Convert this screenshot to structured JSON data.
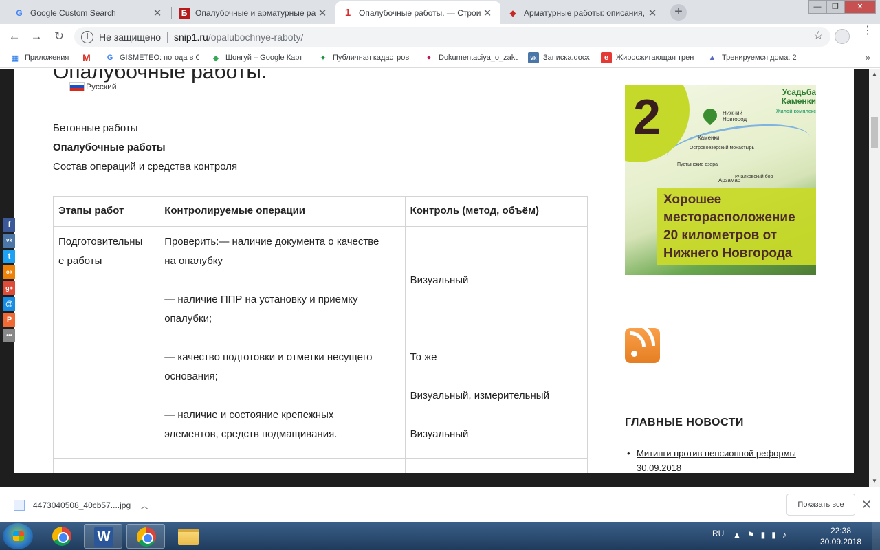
{
  "browser": {
    "tabs": [
      {
        "title": "Google Custom Search",
        "icon": "G",
        "icon_color": "#4285f4",
        "active": false
      },
      {
        "title": "Опалубочные и арматурные работ",
        "icon": "Б",
        "icon_color": "#b71c1c",
        "active": false
      },
      {
        "title": "Опалубочные работы. — Строител",
        "icon": "1",
        "icon_color": "#d32f2f",
        "active": true
      },
      {
        "title": "Арматурные работы: описания, эта",
        "icon": "◆",
        "icon_color": "#c62828",
        "active": false
      }
    ],
    "new_tab_glyph": "+",
    "window_controls": {
      "minimize": "—",
      "maximize": "❐",
      "close": "✕"
    },
    "nav": {
      "back": "←",
      "forward": "→",
      "reload": "↻"
    },
    "security_label": "Не защищено",
    "url_host": "snip1.ru",
    "url_path": "/opalubochnye-raboty/",
    "star": "☆",
    "menu": "⋮",
    "bookmarks": [
      {
        "label": "Приложения",
        "icon": "▦",
        "color": "#1a73e8"
      },
      {
        "label": "",
        "icon": "M",
        "color": "#d93025"
      },
      {
        "label": "GISMETEO: погода в С",
        "icon": "G",
        "color": "#4285f4"
      },
      {
        "label": "Шонгуй – Google Карт",
        "icon": "◆",
        "color": "#34a853"
      },
      {
        "label": "Публичная кадастров",
        "icon": "✦",
        "color": "#1e8e3e"
      },
      {
        "label": "Dokumentaciya_o_zaku",
        "icon": "●",
        "color": "#c2185b"
      },
      {
        "label": "Записка.docx",
        "icon": "vk",
        "color": "#4a76a8"
      },
      {
        "label": "Жиросжигающая трен",
        "icon": "e",
        "color": "#e53935"
      },
      {
        "label": "Тренируемся дома: 2",
        "icon": "▲",
        "color": "#5c6bc0"
      }
    ],
    "bookmarks_more": "»"
  },
  "page": {
    "heading": "Опалубочные работы.",
    "lang_label": "Русский",
    "crumbs": [
      {
        "text": "Бетонные работы",
        "bold": false
      },
      {
        "text": "Опалубочные работы",
        "bold": true
      },
      {
        "text": "Состав операций и средства контроля",
        "bold": false
      }
    ],
    "table": {
      "headers": [
        "Этапы работ",
        "Контролируемые операции",
        "Контроль (метод, объём)"
      ],
      "row1": {
        "stage": [
          "Подготовительны",
          "е работы"
        ],
        "operations": [
          [
            "Проверить:— наличие документа о качестве",
            "на опалубку"
          ],
          [
            "— наличие ППР на установку и приемку",
            "опалубки;"
          ],
          [
            "— качество подготовки и отметки несущего",
            "основания;"
          ],
          [
            "— наличие и состояние крепежных",
            "элементов, средств подмащивания."
          ]
        ],
        "control": [
          "Визуальный",
          "То же",
          "Визуальный, измерительный",
          "Визуальный"
        ]
      }
    },
    "share_buttons": [
      {
        "glyph": "f",
        "color": "#3b5998"
      },
      {
        "glyph": "vk",
        "color": "#4a76a8"
      },
      {
        "glyph": "t",
        "color": "#1da1f2"
      },
      {
        "glyph": "ok",
        "color": "#ee8208"
      },
      {
        "glyph": "g+",
        "color": "#dd4b39"
      },
      {
        "glyph": "@",
        "color": "#168de2"
      },
      {
        "glyph": "P",
        "color": "#f06a35"
      },
      {
        "glyph": "•••",
        "color": "#888888"
      }
    ]
  },
  "sidebar": {
    "ad": {
      "number": "2",
      "logo": "Усадьба Каменки",
      "logo_sub": "Жилой комплекс",
      "towns": [
        "Нижний Новгород",
        "Каменки",
        "Островоезерский монастырь",
        "Пустынские озера",
        "Арзамас",
        "Ичалковский бор"
      ],
      "lines": [
        "Хорошее",
        "месторасположение",
        "20 километров от",
        "Нижнего Новгорода"
      ]
    },
    "news_title": "ГЛАВНЫЕ НОВОСТИ",
    "news": [
      "Митинги против пенсионной реформы 30.09.2018"
    ]
  },
  "downloads": {
    "file": "4473040508_40cb57....jpg",
    "show_all": "Показать все",
    "close": "✕"
  },
  "taskbar": {
    "lang": "RU",
    "time": "22:38",
    "date": "30.09.2018"
  }
}
